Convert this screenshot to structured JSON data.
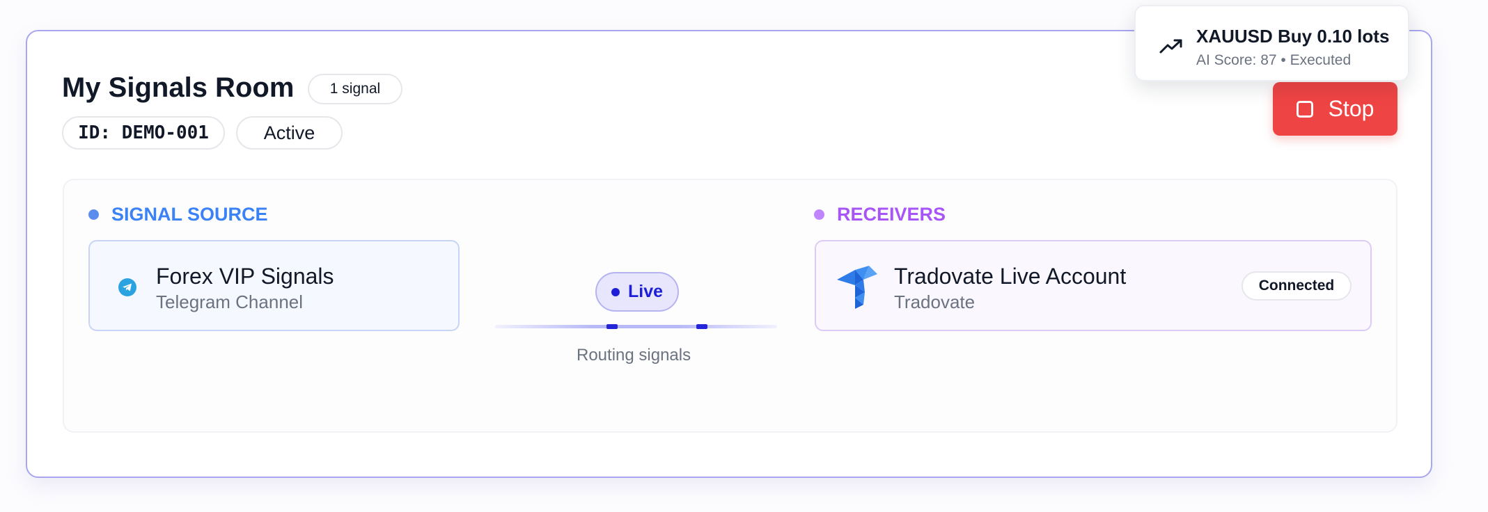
{
  "room": {
    "title": "My Signals Room",
    "signal_count": "1 signal",
    "id": "ID: DEMO-001",
    "status": "Active"
  },
  "actions": {
    "stop_label": "Stop"
  },
  "toast": {
    "icon": "trending-up-icon",
    "title": "XAUUSD Buy 0.10 lots",
    "subtitle": "AI Score: 87 • Executed"
  },
  "source": {
    "section_label": "SIGNAL SOURCE",
    "name": "Forex VIP Signals",
    "type": "Telegram Channel",
    "icon": "telegram-icon"
  },
  "routing": {
    "status": "Live",
    "label": "Routing signals"
  },
  "receivers": {
    "section_label": "RECEIVERS",
    "items": [
      {
        "name": "Tradovate Live Account",
        "platform": "Tradovate",
        "status": "Connected",
        "icon": "tradovate-logo"
      }
    ]
  },
  "colors": {
    "accent": "#6366f1",
    "stop": "#ef4444",
    "source": "#3b82f6",
    "receivers": "#a855f7",
    "live": "#1d1fd8"
  }
}
